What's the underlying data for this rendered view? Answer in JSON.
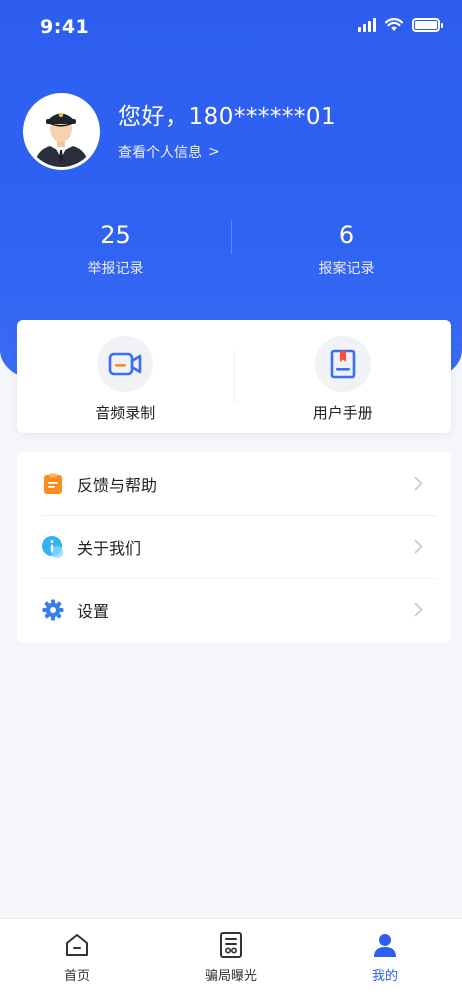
{
  "status_bar": {
    "time": "9:41"
  },
  "profile": {
    "greeting": "您好，180******01",
    "view_info": "查看个人信息",
    "view_info_chevron": ">"
  },
  "stats": [
    {
      "value": "25",
      "label": "举报记录"
    },
    {
      "value": "6",
      "label": "报案记录"
    }
  ],
  "quick_actions": [
    {
      "label": "音频录制",
      "icon": "video-record-icon"
    },
    {
      "label": "用户手册",
      "icon": "manual-book-icon"
    }
  ],
  "menu": [
    {
      "label": "反馈与帮助",
      "icon": "feedback-icon",
      "color": "#ff8a1f"
    },
    {
      "label": "关于我们",
      "icon": "info-icon",
      "color": "#2fb3f2"
    },
    {
      "label": "设置",
      "icon": "gear-icon",
      "color": "#3b7df0"
    }
  ],
  "tabbar": [
    {
      "label": "首页",
      "icon": "home-icon",
      "active": false
    },
    {
      "label": "骗局曝光",
      "icon": "newspaper-icon",
      "active": false
    },
    {
      "label": "我的",
      "icon": "user-icon",
      "active": true
    }
  ],
  "colors": {
    "primary": "#2d5ef0",
    "background": "#f5f6f9",
    "orange": "#ff8a1f",
    "cyan": "#2fb3f2"
  }
}
